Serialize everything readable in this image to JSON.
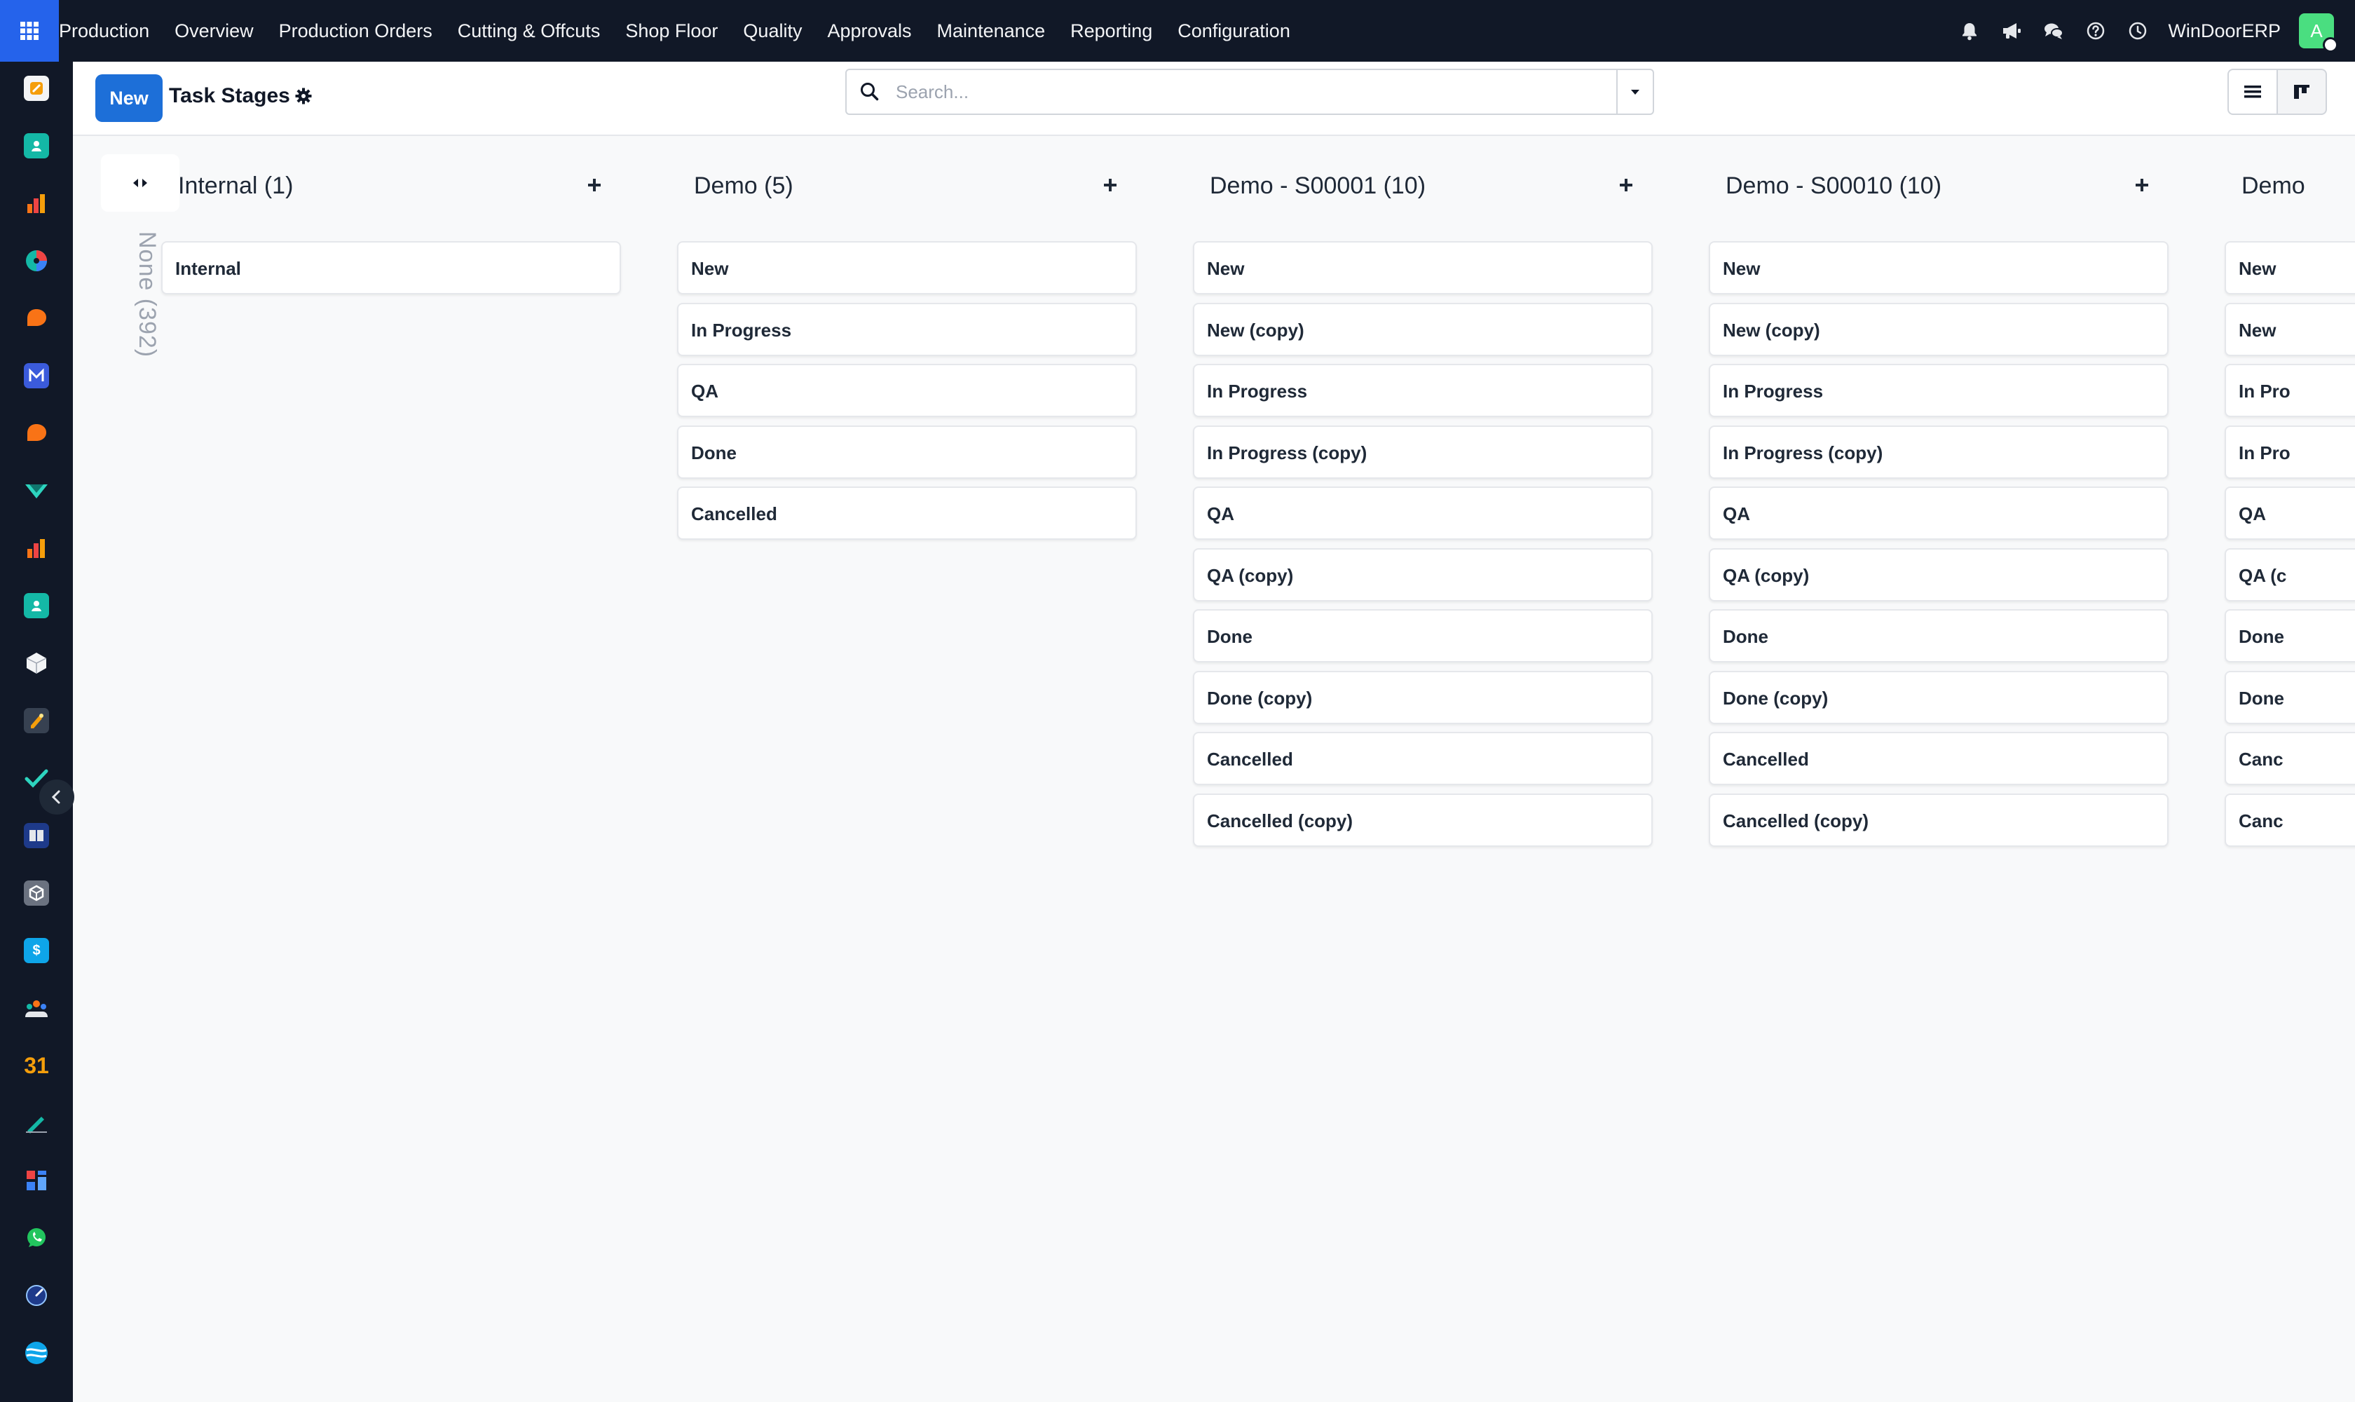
{
  "topbar": {
    "menu": [
      "Production",
      "Overview",
      "Production Orders",
      "Cutting & Offcuts",
      "Shop Floor",
      "Quality",
      "Approvals",
      "Maintenance",
      "Reporting",
      "Configuration"
    ],
    "company": "WinDoorERP",
    "avatar_initial": "A"
  },
  "appbar": {
    "icons": [
      "discuss-icon",
      "contacts-icon",
      "reports-icon",
      "dashboard-icon",
      "chat-icon",
      "mail-icon",
      "livechat-icon",
      "inventory-icon",
      "sales-icon",
      "employees-icon",
      "product-icon",
      "purchase-icon",
      "todo-icon",
      "knowledge-icon",
      "package-icon",
      "invoicing-icon",
      "team-icon",
      "calendar-icon",
      "sign-icon",
      "apps-grid-icon",
      "whatsapp-icon",
      "timer-icon",
      "website-icon"
    ],
    "calendar_day": "31"
  },
  "control": {
    "new_label": "New",
    "title": "Task Stages",
    "search_placeholder": "Search..."
  },
  "kanban": {
    "folded_label": "None (392)",
    "columns": [
      {
        "title": "Internal (1)",
        "cards": [
          "Internal"
        ]
      },
      {
        "title": "Demo (5)",
        "cards": [
          "New",
          "In Progress",
          "QA",
          "Done",
          "Cancelled"
        ]
      },
      {
        "title": "Demo - S00001 (10)",
        "cards": [
          "New",
          "New (copy)",
          "In Progress",
          "In Progress (copy)",
          "QA",
          "QA (copy)",
          "Done",
          "Done (copy)",
          "Cancelled",
          "Cancelled (copy)"
        ]
      },
      {
        "title": "Demo - S00010 (10)",
        "cards": [
          "New",
          "New (copy)",
          "In Progress",
          "In Progress (copy)",
          "QA",
          "QA (copy)",
          "Done",
          "Done (copy)",
          "Cancelled",
          "Cancelled (copy)"
        ]
      },
      {
        "title": "Demo",
        "cards": [
          "New",
          "New",
          "In Pro",
          "In Pro",
          "QA",
          "QA (c",
          "Done",
          "Done",
          "Canc",
          "Canc"
        ]
      }
    ]
  },
  "colors": {
    "navbar": "#111827",
    "primary": "#1d6fd8",
    "apps_button": "#2563eb",
    "avatar": "#4ade80"
  }
}
